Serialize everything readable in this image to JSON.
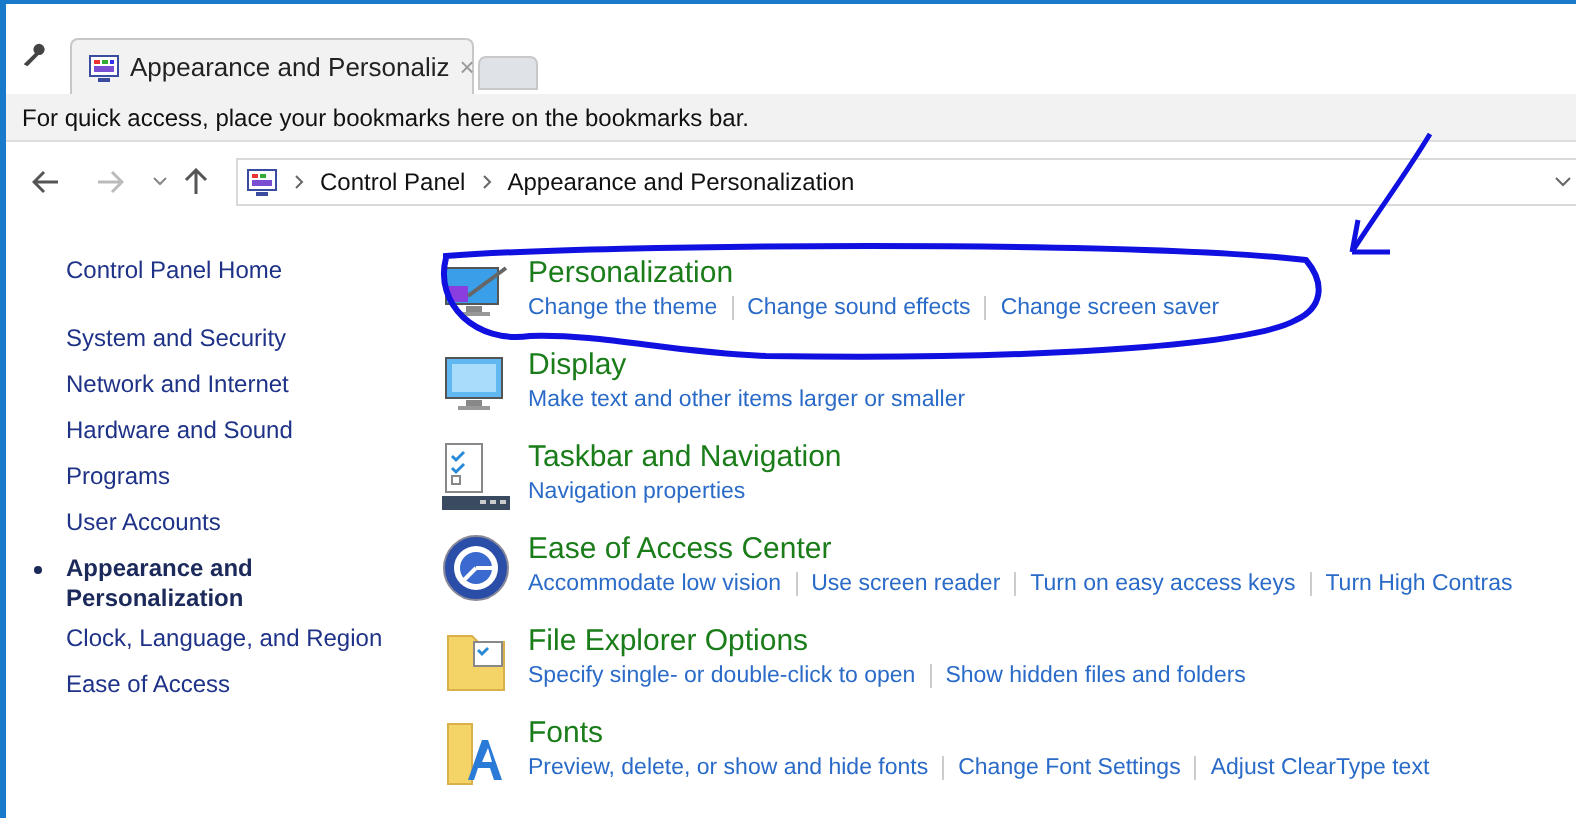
{
  "tab": {
    "title": "Appearance and Personaliz",
    "close": "×"
  },
  "bookmarks_bar": {
    "text": "For quick access, place your bookmarks here on the bookmarks bar."
  },
  "address_bar": {
    "breadcrumbs": [
      "Control Panel",
      "Appearance and Personalization"
    ]
  },
  "sidebar": {
    "items": [
      {
        "label": "Control Panel Home",
        "selected": false,
        "kind": "home"
      },
      {
        "label": "System and Security",
        "selected": false,
        "kind": "link"
      },
      {
        "label": "Network and Internet",
        "selected": false,
        "kind": "link"
      },
      {
        "label": "Hardware and Sound",
        "selected": false,
        "kind": "link"
      },
      {
        "label": "Programs",
        "selected": false,
        "kind": "link"
      },
      {
        "label": "User Accounts",
        "selected": false,
        "kind": "link"
      },
      {
        "label": "Appearance and Personalization",
        "selected": true,
        "kind": "link"
      },
      {
        "label": "Clock, Language, and Region",
        "selected": false,
        "kind": "link"
      },
      {
        "label": "Ease of Access",
        "selected": false,
        "kind": "link"
      }
    ]
  },
  "categories": [
    {
      "kind": "personalization",
      "title": "Personalization",
      "links": [
        "Change the theme",
        "Change sound effects",
        "Change screen saver"
      ]
    },
    {
      "kind": "display",
      "title": "Display",
      "links": [
        "Make text and other items larger or smaller"
      ]
    },
    {
      "kind": "taskbar",
      "title": "Taskbar and Navigation",
      "links": [
        "Navigation properties"
      ]
    },
    {
      "kind": "ease",
      "title": "Ease of Access Center",
      "links": [
        "Accommodate low vision",
        "Use screen reader",
        "Turn on easy access keys",
        "Turn High Contras"
      ]
    },
    {
      "kind": "folder",
      "title": "File Explorer Options",
      "links": [
        "Specify single- or double-click to open",
        "Show hidden files and folders"
      ]
    },
    {
      "kind": "fonts",
      "title": "Fonts",
      "links": [
        "Preview, delete, or show and hide fonts",
        "Change Font Settings",
        "Adjust ClearType text"
      ]
    }
  ]
}
